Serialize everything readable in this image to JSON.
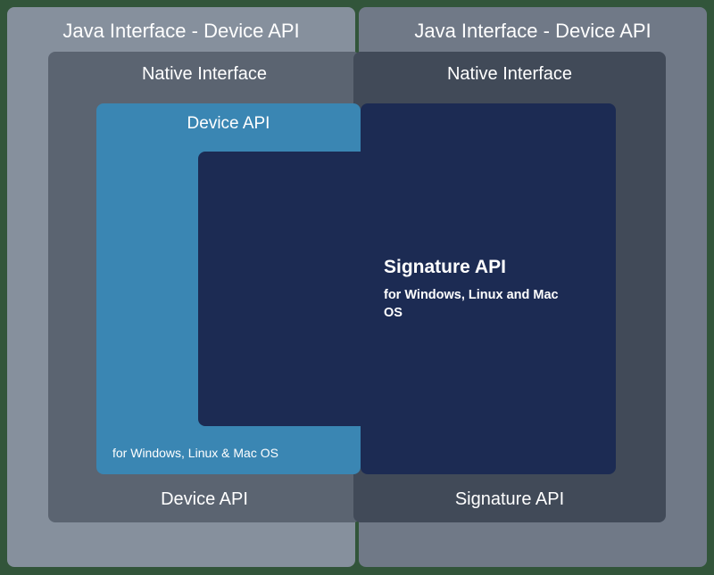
{
  "outer": {
    "left_title": "Java Interface - Device API",
    "right_title": "Java Interface - Device API"
  },
  "native": {
    "left_title": "Native Interface",
    "right_title": "Native Interface",
    "left_footer": "Device API",
    "right_footer": "Signature API"
  },
  "device": {
    "title": "Device API",
    "footer": "for Windows, Linux & Mac OS"
  },
  "signature": {
    "title": "Signature API",
    "subtitle": "for Windows, Linux and Mac OS"
  },
  "colors": {
    "java_left": "#86909d",
    "java_right": "#707987",
    "native_left": "#5b6471",
    "native_right": "#414a58",
    "device": "#3a86b3",
    "signature": "#1c2b53",
    "bg": "#32553a"
  }
}
